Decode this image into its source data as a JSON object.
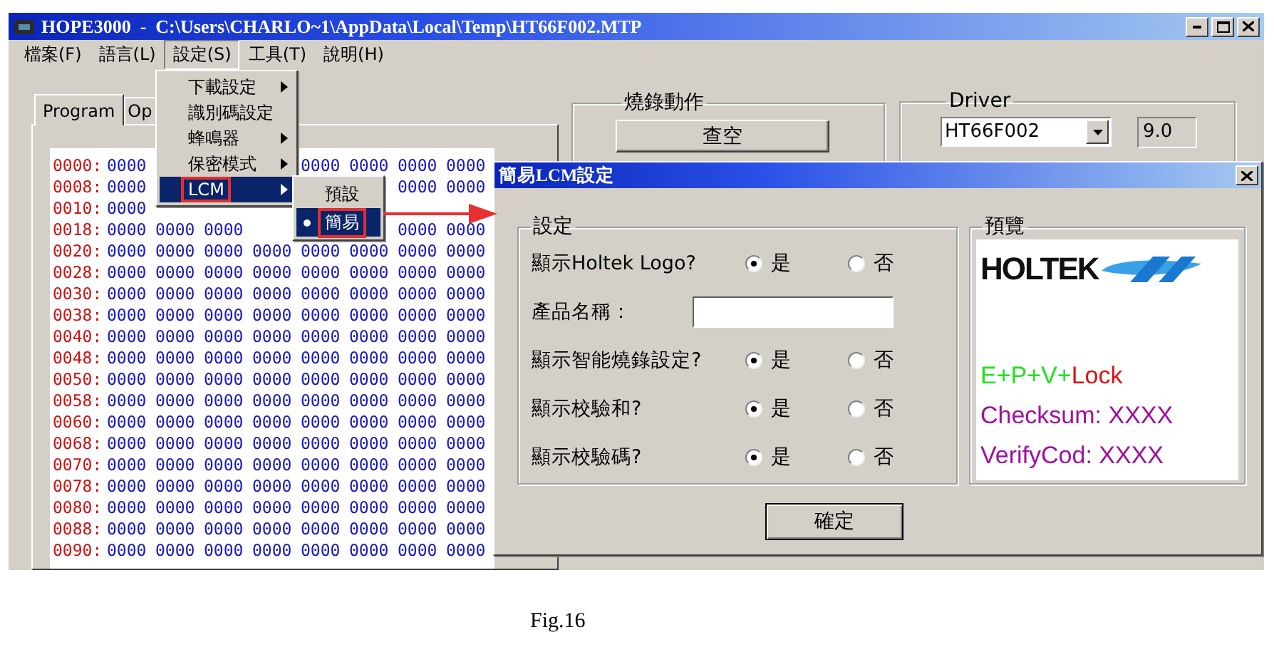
{
  "window": {
    "title": "HOPE3000  -  C:\\Users\\CHARLO~1\\AppData\\Local\\Temp\\HT66F002.MTP"
  },
  "menu_bar": [
    {
      "label": "檔案(F)",
      "selected": false
    },
    {
      "label": "語言(L)",
      "selected": false
    },
    {
      "label": "設定(S)",
      "selected": true
    },
    {
      "label": "工具(T)",
      "selected": false
    },
    {
      "label": "說明(H)",
      "selected": false
    }
  ],
  "menu": {
    "items": [
      {
        "label": "下載設定",
        "submenu": true,
        "selected": false
      },
      {
        "label": "識別碼設定",
        "submenu": false,
        "selected": false
      },
      {
        "label": "蜂鳴器",
        "submenu": true,
        "selected": false
      },
      {
        "label": "保密模式",
        "submenu": true,
        "selected": false
      },
      {
        "label": "LCM",
        "submenu": true,
        "selected": true
      }
    ]
  },
  "submenu": {
    "items": [
      {
        "label": "預設",
        "checked": false,
        "selected": false
      },
      {
        "label": "簡易",
        "checked": true,
        "selected": true
      }
    ]
  },
  "tabs": [
    {
      "label": "Program",
      "selected": true
    },
    {
      "label": "Op",
      "selected": false
    }
  ],
  "hex_rows": [
    {
      "address": "0000:",
      "cells": [
        "0000",
        null,
        null,
        null,
        "0000",
        "0000",
        "0000",
        "0000"
      ]
    },
    {
      "address": "0008:",
      "cells": [
        "0000",
        null,
        null,
        null,
        null,
        null,
        "0000",
        "0000"
      ]
    },
    {
      "address": "0010:",
      "cells": [
        "0000",
        null,
        null,
        null,
        null,
        null,
        null,
        null
      ]
    },
    {
      "address": "0018:",
      "cells": [
        "0000",
        "0000",
        "0000",
        null,
        null,
        null,
        "0000",
        "0000"
      ]
    },
    {
      "address": "0020:",
      "cells": [
        "0000",
        "0000",
        "0000",
        "0000",
        "0000",
        "0000",
        "0000",
        "0000"
      ]
    },
    {
      "address": "0028:",
      "cells": [
        "0000",
        "0000",
        "0000",
        "0000",
        "0000",
        "0000",
        "0000",
        "0000"
      ]
    },
    {
      "address": "0030:",
      "cells": [
        "0000",
        "0000",
        "0000",
        "0000",
        "0000",
        "0000",
        "0000",
        "0000"
      ]
    },
    {
      "address": "0038:",
      "cells": [
        "0000",
        "0000",
        "0000",
        "0000",
        "0000",
        "0000",
        "0000",
        "0000"
      ]
    },
    {
      "address": "0040:",
      "cells": [
        "0000",
        "0000",
        "0000",
        "0000",
        "0000",
        "0000",
        "0000",
        "0000"
      ]
    },
    {
      "address": "0048:",
      "cells": [
        "0000",
        "0000",
        "0000",
        "0000",
        "0000",
        "0000",
        "0000",
        "0000"
      ]
    },
    {
      "address": "0050:",
      "cells": [
        "0000",
        "0000",
        "0000",
        "0000",
        "0000",
        "0000",
        "0000",
        "0000"
      ]
    },
    {
      "address": "0058:",
      "cells": [
        "0000",
        "0000",
        "0000",
        "0000",
        "0000",
        "0000",
        "0000",
        "0000"
      ]
    },
    {
      "address": "0060:",
      "cells": [
        "0000",
        "0000",
        "0000",
        "0000",
        "0000",
        "0000",
        "0000",
        "0000"
      ]
    },
    {
      "address": "0068:",
      "cells": [
        "0000",
        "0000",
        "0000",
        "0000",
        "0000",
        "0000",
        "0000",
        "0000"
      ]
    },
    {
      "address": "0070:",
      "cells": [
        "0000",
        "0000",
        "0000",
        "0000",
        "0000",
        "0000",
        "0000",
        "0000"
      ]
    },
    {
      "address": "0078:",
      "cells": [
        "0000",
        "0000",
        "0000",
        "0000",
        "0000",
        "0000",
        "0000",
        "0000"
      ]
    },
    {
      "address": "0080:",
      "cells": [
        "0000",
        "0000",
        "0000",
        "0000",
        "0000",
        "0000",
        "0000",
        "0000"
      ]
    },
    {
      "address": "0088:",
      "cells": [
        "0000",
        "0000",
        "0000",
        "0000",
        "0000",
        "0000",
        "0000",
        "0000"
      ]
    },
    {
      "address": "0090:",
      "cells": [
        "0000",
        "0000",
        "0000",
        "0000",
        "0000",
        "0000",
        "0000",
        "0000"
      ]
    }
  ],
  "burn_group": {
    "title": "燒錄動作",
    "button": "查空"
  },
  "driver_group": {
    "title": "Driver",
    "device": "HT66F002",
    "version": "9.0"
  },
  "dialog": {
    "title": "簡易LCM設定",
    "settings": {
      "title": "設定",
      "rows": [
        {
          "kind": "choice",
          "label": "顯示Holtek Logo?",
          "options": [
            {
              "label": "是",
              "selected": true
            },
            {
              "label": "否",
              "selected": false
            }
          ]
        },
        {
          "kind": "field",
          "label": "產品名稱："
        },
        {
          "kind": "choice",
          "label": "顯示智能燒錄設定?",
          "options": [
            {
              "label": "是",
              "selected": true
            },
            {
              "label": "否",
              "selected": false
            }
          ]
        },
        {
          "kind": "choice",
          "label": "顯示校驗和?",
          "options": [
            {
              "label": "是",
              "selected": true
            },
            {
              "label": "否",
              "selected": false
            }
          ]
        },
        {
          "kind": "choice",
          "label": "顯示校驗碼?",
          "options": [
            {
              "label": "是",
              "selected": true
            },
            {
              "label": "否",
              "selected": false
            }
          ]
        }
      ]
    },
    "preview": {
      "title": "預覽",
      "logo": "HOLTEK",
      "lines": [
        {
          "parts": [
            {
              "text": "E+P+V+",
              "color": "#22e022"
            },
            {
              "text": "Lock",
              "color": "#e01010"
            }
          ]
        },
        {
          "parts": [
            {
              "text": "Checksum: XXXX",
              "color": "#a010a0"
            }
          ]
        },
        {
          "parts": [
            {
              "text": "VerifyCod: XXXX",
              "color": "#a010a0"
            }
          ]
        }
      ]
    },
    "ok_button": "確定"
  },
  "caption": "Fig.16"
}
